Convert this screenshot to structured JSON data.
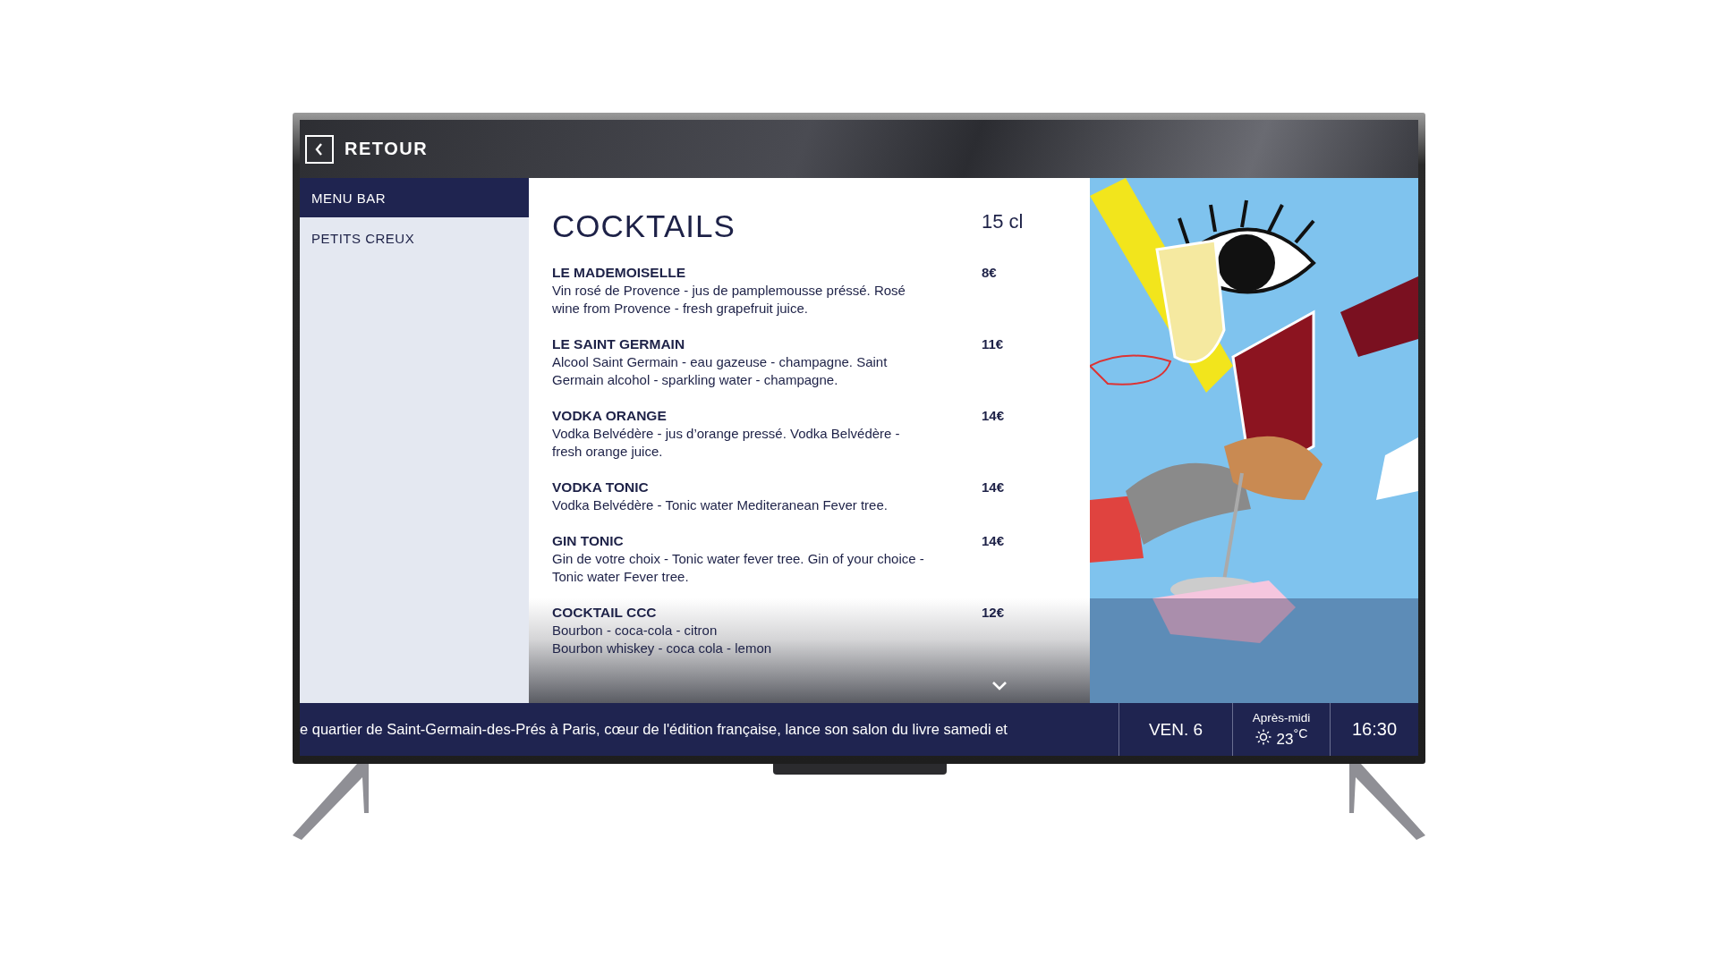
{
  "header": {
    "back_label": "RETOUR"
  },
  "sidebar": {
    "items": [
      {
        "label": "MENU BAR",
        "selected": true
      },
      {
        "label": "PETITS CREUX",
        "selected": false
      }
    ]
  },
  "menu": {
    "title": "COCKTAILS",
    "volume": "15 cl",
    "items": [
      {
        "name": "LE MADEMOISELLE",
        "description": "Vin rosé de Provence - jus de pamplemousse préssé. Rosé wine from Provence - fresh grapefruit juice.",
        "price": "8€"
      },
      {
        "name": "LE SAINT GERMAIN",
        "description": "Alcool Saint Germain - eau gazeuse - champagne. Saint Germain alcohol - sparkling water - champagne.",
        "price": "11€"
      },
      {
        "name": "VODKA ORANGE",
        "description": "Vodka Belvédère - jus d’orange pressé. Vodka Belvédère - fresh orange juice.",
        "price": "14€"
      },
      {
        "name": "VODKA TONIC",
        "description": "Vodka Belvédère - Tonic water Mediteranean Fever tree.",
        "price": "14€"
      },
      {
        "name": "GIN TONIC",
        "description": "Gin de votre choix - Tonic water fever tree. Gin of your choice - Tonic water Fever tree.",
        "price": "14€"
      },
      {
        "name": "COCKTAIL CCC",
        "description": "Bourbon - coca-cola - citron\nBourbon whiskey - coca cola - lemon",
        "price": "12€"
      }
    ]
  },
  "status_bar": {
    "ticker": "e quartier de Saint-Germain-des-Prés à Paris, cœur de l'édition française, lance son salon du livre samedi et",
    "date": "VEN. 6",
    "period": "Après-midi",
    "temperature": "23$^{°C}$",
    "time": "16:30"
  }
}
